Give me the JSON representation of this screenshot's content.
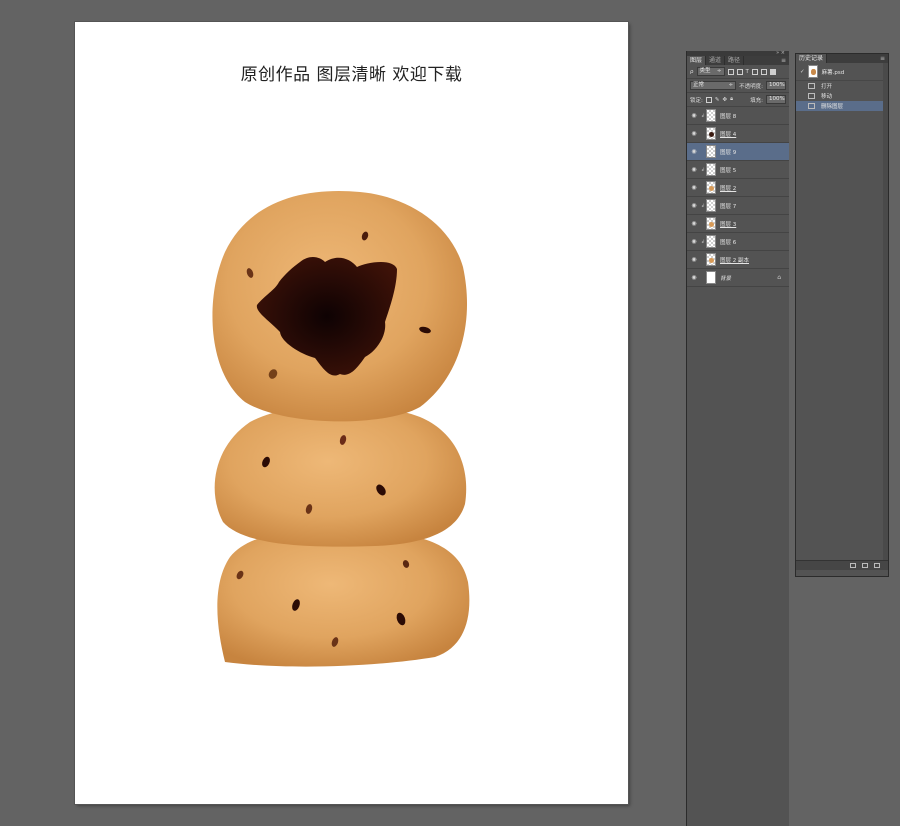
{
  "document": {
    "title": "原创作品 图层清晰 欢迎下载"
  },
  "layers_panel": {
    "tabs": [
      {
        "label": "图层",
        "active": true
      },
      {
        "label": "通道",
        "active": false
      },
      {
        "label": "路径",
        "active": false
      }
    ],
    "filter_kind": "类型",
    "blend_mode": "正常",
    "opacity_label": "不透明度:",
    "opacity_value": "100%",
    "lock_label": "锁定:",
    "fill_label": "填充:",
    "fill_value": "100%",
    "layers": [
      {
        "name": "图层 8",
        "selected": false,
        "underlined": false,
        "linked": true
      },
      {
        "name": "图层 4",
        "selected": false,
        "underlined": true,
        "linked": false
      },
      {
        "name": "图层 9",
        "selected": true,
        "underlined": false,
        "linked": false
      },
      {
        "name": "图层 5",
        "selected": false,
        "underlined": false,
        "linked": true
      },
      {
        "name": "图层 2",
        "selected": false,
        "underlined": true,
        "linked": false
      },
      {
        "name": "图层 7",
        "selected": false,
        "underlined": false,
        "linked": true
      },
      {
        "name": "图层 3",
        "selected": false,
        "underlined": true,
        "linked": false
      },
      {
        "name": "图层 6",
        "selected": false,
        "underlined": false,
        "linked": true
      },
      {
        "name": "图层 2 副本",
        "selected": false,
        "underlined": true,
        "linked": false
      },
      {
        "name": "背景",
        "selected": false,
        "underlined": false,
        "linked": false
      }
    ]
  },
  "history_panel": {
    "tab_label": "历史记录",
    "snapshot_name": "麻薯.psd",
    "items": [
      {
        "label": "打开",
        "selected": false
      },
      {
        "label": "移动",
        "selected": false
      },
      {
        "label": "删除图层",
        "selected": true
      }
    ]
  },
  "colors": {
    "dough": "#e0a562",
    "dough_edge": "#c8843f",
    "filling": "#2a0906",
    "speck": "#5a2812",
    "selected_row": "#5a6d8a"
  }
}
